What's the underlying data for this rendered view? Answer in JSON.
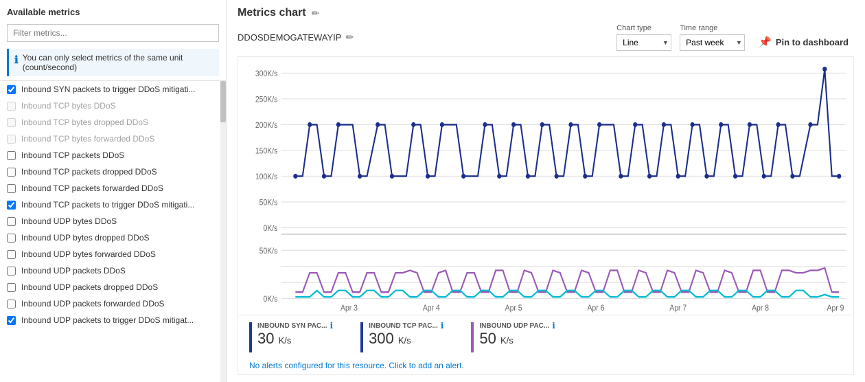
{
  "left": {
    "header": "Available metrics",
    "filter_placeholder": "Filter metrics...",
    "info_text": "You can only select metrics of the same unit (count/second)",
    "metrics": [
      {
        "id": 1,
        "label": "Inbound SYN packets to trigger DDoS mitigati...",
        "checked": true,
        "disabled": false
      },
      {
        "id": 2,
        "label": "Inbound TCP bytes DDoS",
        "checked": false,
        "disabled": true
      },
      {
        "id": 3,
        "label": "Inbound TCP bytes dropped DDoS",
        "checked": false,
        "disabled": true
      },
      {
        "id": 4,
        "label": "Inbound TCP bytes forwarded DDoS",
        "checked": false,
        "disabled": true
      },
      {
        "id": 5,
        "label": "Inbound TCP packets DDoS",
        "checked": false,
        "disabled": false
      },
      {
        "id": 6,
        "label": "Inbound TCP packets dropped DDoS",
        "checked": false,
        "disabled": false
      },
      {
        "id": 7,
        "label": "Inbound TCP packets forwarded DDoS",
        "checked": false,
        "disabled": false
      },
      {
        "id": 8,
        "label": "Inbound TCP packets to trigger DDoS mitigati...",
        "checked": true,
        "disabled": false
      },
      {
        "id": 9,
        "label": "Inbound UDP bytes DDoS",
        "checked": false,
        "disabled": false
      },
      {
        "id": 10,
        "label": "Inbound UDP bytes dropped DDoS",
        "checked": false,
        "disabled": false
      },
      {
        "id": 11,
        "label": "Inbound UDP bytes forwarded DDoS",
        "checked": false,
        "disabled": false
      },
      {
        "id": 12,
        "label": "Inbound UDP packets DDoS",
        "checked": false,
        "disabled": false
      },
      {
        "id": 13,
        "label": "Inbound UDP packets dropped DDoS",
        "checked": false,
        "disabled": false
      },
      {
        "id": 14,
        "label": "Inbound UDP packets forwarded DDoS",
        "checked": false,
        "disabled": false
      },
      {
        "id": 15,
        "label": "Inbound UDP packets to trigger DDoS mitigat...",
        "checked": true,
        "disabled": false
      }
    ]
  },
  "right": {
    "title": "Metrics chart",
    "resource_name": "DDOSDEMOGATEWAYIP",
    "chart_type_label": "Chart type",
    "chart_type_value": "Line",
    "time_range_label": "Time range",
    "time_range_value": "Past week",
    "pin_label": "Pin to dashboard",
    "y_labels": [
      "300K/s",
      "250K/s",
      "200K/s",
      "150K/s",
      "100K/s",
      "50K/s",
      "0K/s"
    ],
    "x_labels": [
      "Apr 3",
      "Apr 4",
      "Apr 5",
      "Apr 6",
      "Apr 7",
      "Apr 8",
      "Apr 9"
    ],
    "legend": [
      {
        "id": "syn",
        "name": "INBOUND SYN PAC...",
        "value": "30",
        "unit": "K/s",
        "color": "#1f3a93"
      },
      {
        "id": "tcp",
        "name": "INBOUND TCP PAC...",
        "value": "300",
        "unit": "K/s",
        "color": "#1f3a93"
      },
      {
        "id": "udp",
        "name": "INBOUND UDP PAC...",
        "value": "50",
        "unit": "K/s",
        "color": "#9b59b6"
      }
    ],
    "alert_text": "No alerts configured for this resource. Click to add an alert.",
    "alert_link": "No alerts configured for this resource. Click to add an alert."
  }
}
